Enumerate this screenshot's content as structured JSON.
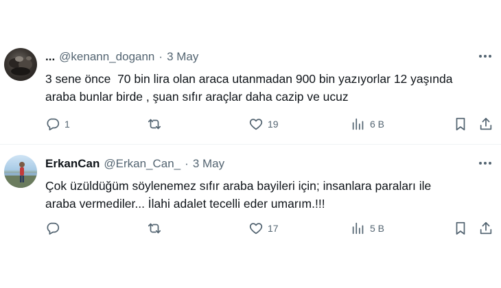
{
  "tweets": [
    {
      "display_name": "...",
      "handle": "@kenann_dogann",
      "separator": "·",
      "time": "3 May",
      "text": "3 sene önce  70 bin lira olan araca utanmadan 900 bin yazıyorlar 12 yaşında\naraba bunlar birde , şuan sıfır araçlar daha cazip ve ucuz",
      "reply_count": "1",
      "retweet_count": "",
      "like_count": "19",
      "view_count": "6 B"
    },
    {
      "display_name": "ErkanCan",
      "handle": "@Erkan_Can_",
      "separator": "·",
      "time": "3 May",
      "text": "Çok üzüldüğüm söylenemez sıfır araba bayileri için; insanlara paraları ile\naraba vermediler... İlahi adalet tecelli eder umarım.!!!",
      "reply_count": "",
      "retweet_count": "",
      "like_count": "17",
      "view_count": "5 B"
    }
  ],
  "icons": {
    "reply": "reply-icon",
    "retweet": "retweet-icon",
    "like": "heart-icon",
    "views": "views-icon",
    "bookmark": "bookmark-icon",
    "share": "share-icon",
    "more": "more-icon"
  },
  "colors": {
    "text_primary": "#0f1419",
    "text_secondary": "#536471",
    "divider": "#eff3f4"
  }
}
